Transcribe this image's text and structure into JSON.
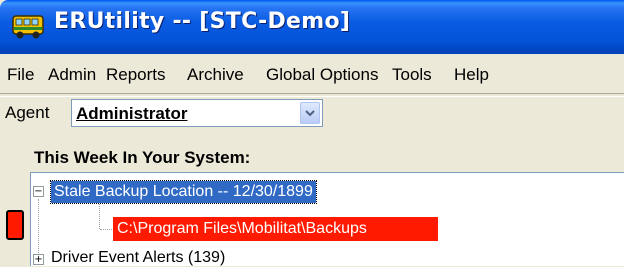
{
  "window": {
    "title": "ERUtility -- [STC-Demo]",
    "icon": "bus-app-icon"
  },
  "menu": {
    "items": [
      "File",
      "Admin",
      "Reports",
      "Archive",
      "Global Options",
      "Tools",
      "Help"
    ]
  },
  "agent": {
    "label": "Agent",
    "value": "Administrator"
  },
  "section": {
    "title": "This Week In Your System:"
  },
  "tree": {
    "nodes": [
      {
        "label": "Stale Backup Location -- 12/30/1899",
        "expanded": true,
        "selected": true
      },
      {
        "label": "C:\\Program Files\\Mobilitat\\Backups",
        "highlight": "#ff1a00"
      },
      {
        "label": "Driver Event Alerts (139)",
        "expanded": false
      }
    ]
  },
  "colors": {
    "titlebar": "#0453d8",
    "selection": "#316ac5",
    "alert": "#ff1a00",
    "window_bg": "#ece9d8"
  }
}
